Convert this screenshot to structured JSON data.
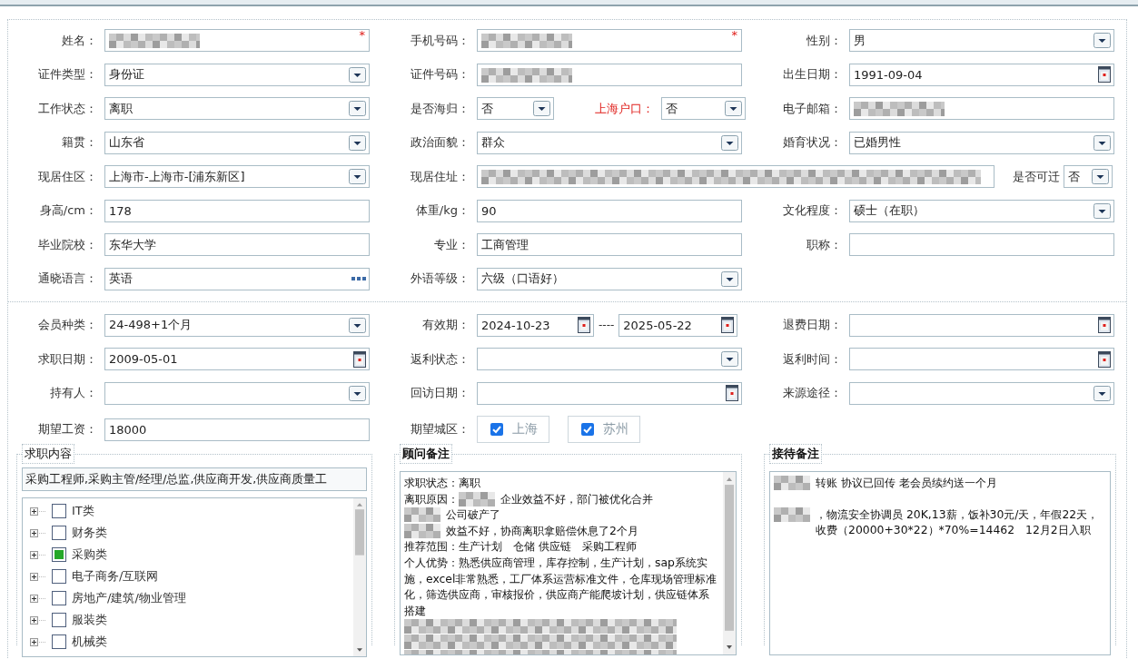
{
  "top_form": {
    "rows": [
      [
        {
          "kind": "text",
          "label": "姓名：",
          "masked": true,
          "required_mark": "*"
        },
        {
          "kind": "text",
          "label": "手机号码：",
          "masked": true,
          "required_mark": "*"
        },
        {
          "kind": "select",
          "label": "性别：",
          "value": "男"
        }
      ],
      [
        {
          "kind": "select",
          "label": "证件类型：",
          "value": "身份证"
        },
        {
          "kind": "text",
          "label": "证件号码：",
          "masked": true
        },
        {
          "kind": "date",
          "label": "出生日期：",
          "value": "1991-09-04"
        }
      ],
      [
        {
          "kind": "select",
          "label": "工作状态：",
          "value": "离职"
        },
        {
          "kind": "dual_select",
          "label": "是否海归：",
          "value": "否",
          "second_label": "上海户口：",
          "second_value": "否"
        },
        {
          "kind": "text",
          "label": "电子邮箱：",
          "masked": true
        }
      ],
      [
        {
          "kind": "select",
          "label": "籍贯：",
          "value": "山东省"
        },
        {
          "kind": "select",
          "label": "政治面貌：",
          "value": "群众"
        },
        {
          "kind": "select",
          "label": "婚育状况：",
          "value": "已婚男性"
        }
      ],
      [
        {
          "kind": "select",
          "label": "现居住区：",
          "value": "上海市-上海市-[浦东新区]"
        },
        {
          "kind": "address",
          "label": "现居住址：",
          "masked": true,
          "second_label": "是否可迁",
          "second_value": "否"
        }
      ],
      [
        {
          "kind": "text",
          "label": "身高/cm：",
          "value": "178"
        },
        {
          "kind": "text",
          "label": "体重/kg：",
          "value": "90"
        },
        {
          "kind": "select",
          "label": "文化程度：",
          "value": "硕士（在职）"
        }
      ],
      [
        {
          "kind": "text",
          "label": "毕业院校：",
          "value": "东华大学"
        },
        {
          "kind": "text",
          "label": "专业：",
          "value": "工商管理"
        },
        {
          "kind": "text",
          "label": "职称："
        }
      ],
      [
        {
          "kind": "lookup",
          "label": "通晓语言：",
          "value": "英语"
        },
        {
          "kind": "select",
          "label": "外语等级：",
          "value": "六级（口语好）"
        }
      ]
    ]
  },
  "bottom_form": {
    "rows": [
      [
        {
          "kind": "select",
          "label": "会员种类：",
          "value": "24-498+1个月"
        },
        {
          "kind": "date_range",
          "label": "有效期：",
          "value": "2024-10-23",
          "separator": "----",
          "second_value": "2025-05-22"
        },
        {
          "kind": "date",
          "label": "退费日期："
        }
      ],
      [
        {
          "kind": "date",
          "label": "求职日期：",
          "value": "2009-05-01"
        },
        {
          "kind": "select",
          "label": "返利状态："
        },
        {
          "kind": "date",
          "label": "返利时间："
        }
      ],
      [
        {
          "kind": "select",
          "label": "持有人："
        },
        {
          "kind": "date",
          "label": "回访日期："
        },
        {
          "kind": "select",
          "label": "来源途径："
        }
      ],
      [
        {
          "kind": "text",
          "label": "期望工资：",
          "value": "18000"
        },
        {
          "kind": "checks",
          "label": "期望城区：",
          "options": [
            {
              "label": "上海",
              "checked": true
            },
            {
              "label": "苏州",
              "checked": true
            }
          ]
        }
      ]
    ]
  },
  "job_panel": {
    "title": "求职内容",
    "selected_text": "采购工程师,采购主管/经理/总监,供应商开发,供应商质量工",
    "categories": [
      {
        "label": "IT类",
        "checked": false
      },
      {
        "label": "财务类",
        "checked": false
      },
      {
        "label": "采购类",
        "checked": true
      },
      {
        "label": "电子商务/互联网",
        "checked": false
      },
      {
        "label": "房地产/建筑/物业管理",
        "checked": false
      },
      {
        "label": "服装类",
        "checked": false
      },
      {
        "label": "机械类",
        "checked": false
      }
    ]
  },
  "advisor_panel": {
    "title": "顾问备注",
    "paragraphs": [
      [
        {
          "text": "求职状态：离职"
        }
      ],
      [
        {
          "text": "离职原因："
        },
        {
          "masked": true
        },
        {
          "text": "企业效益不好，部门被优化合并"
        }
      ],
      [
        {
          "masked": true
        },
        {
          "text": "公司破产了"
        }
      ],
      [
        {
          "masked": true
        },
        {
          "text": "效益不好，协商离职拿赔偿休息了2个月"
        }
      ],
      [
        {
          "text": "推荐范围：生产计划　仓储 供应链　采购工程师"
        }
      ],
      [
        {
          "text": "个人优势：熟悉供应商管理，库存控制，生产计划，sap系统实施，excel非常熟悉，工厂体系运营标准文件，仓库现场管理标准化，筛选供应商，审核报价，供应商产能爬坡计划，供应链体系搭建"
        }
      ],
      [
        {
          "masked": true
        }
      ],
      [
        {
          "masked": true
        }
      ],
      [
        {
          "masked": true
        }
      ]
    ]
  },
  "reception_panel": {
    "title": "接待备注",
    "paragraphs": [
      [
        {
          "masked": true
        },
        {
          "text": "转账 协议已回传 老会员续约送一个月"
        }
      ],
      [
        {
          "masked": true
        },
        {
          "text": "，物流安全协调员 20K,13薪，饭补30元/天，年假22天，收费（20000+30*22）*70%=14462　12月2日入职"
        }
      ]
    ]
  }
}
